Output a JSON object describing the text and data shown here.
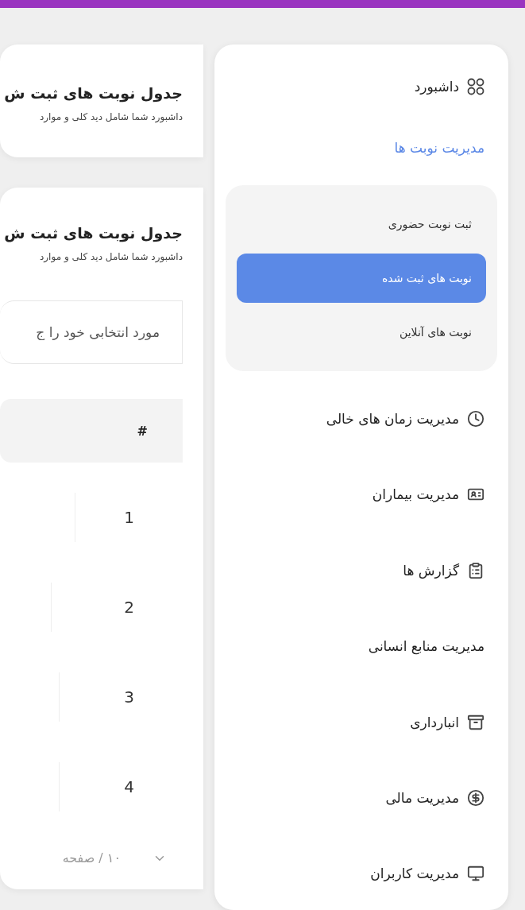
{
  "summary_card": {
    "title": "جدول نوبت های ثبت ش",
    "subtitle": "داشبورد شما شامل دید کلی و موارد"
  },
  "table_card": {
    "title": "جدول نوبت های ثبت ش",
    "subtitle": "داشبورد شما شامل دید کلی و موارد",
    "search": {
      "placeholder": "مورد انتخابی خود را ج"
    },
    "table": {
      "columns": [
        "#"
      ],
      "rows": [
        {
          "number": "1"
        },
        {
          "number": "2"
        },
        {
          "number": "3"
        },
        {
          "number": "4"
        }
      ]
    },
    "pagination": {
      "page_size": "۱۰ / صفحه"
    }
  },
  "sidebar": {
    "items": [
      {
        "label": "داشبورد",
        "selected": false
      },
      {
        "label": "مدیریت نوبت ها",
        "expanded": true,
        "children": [
          {
            "label": "ثبت نوبت حضوری",
            "selected": false
          },
          {
            "label": "نوبت های ثبت شده",
            "selected": true
          },
          {
            "label": "نوبت های آنلاین",
            "selected": false
          }
        ]
      },
      {
        "label": "مدیریت زمان های خالی",
        "selected": false
      },
      {
        "label": "مدیریت بیماران",
        "selected": false
      },
      {
        "label": "گزارش ها",
        "selected": false
      },
      {
        "label": "مدیریت منابع انسانی",
        "selected": false
      },
      {
        "label": "انبارداری",
        "selected": false
      },
      {
        "label": "مدیریت مالی",
        "selected": false
      },
      {
        "label": "مدیریت کاربران",
        "selected": false
      }
    ]
  }
}
